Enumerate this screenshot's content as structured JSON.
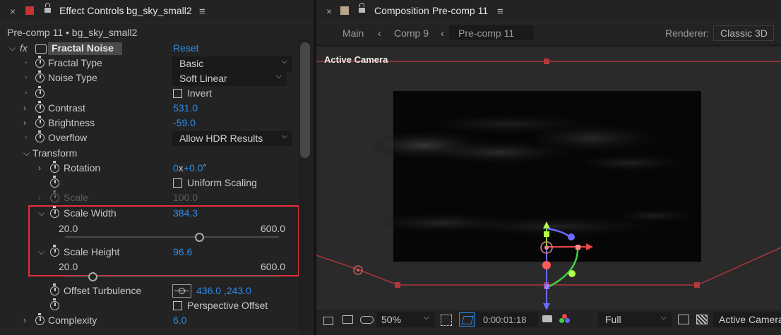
{
  "effect_panel": {
    "tab_close": "×",
    "tab_title": "Effect Controls",
    "tab_layer": "bg_sky_small2",
    "tab_menu": "≡",
    "subtitle": "Pre-comp 11 • bg_sky_small2",
    "effect": {
      "fx_label": "fx",
      "name": "Fractal Noise",
      "reset": "Reset"
    },
    "properties": {
      "fractal_type": {
        "label": "Fractal Type",
        "value": "Basic"
      },
      "noise_type": {
        "label": "Noise Type",
        "value": "Soft Linear"
      },
      "invert": {
        "label": "Invert"
      },
      "contrast": {
        "label": "Contrast",
        "value": "531.0"
      },
      "brightness": {
        "label": "Brightness",
        "value": "-59.0"
      },
      "overflow": {
        "label": "Overflow",
        "value": "Allow HDR Results"
      },
      "transform": {
        "label": "Transform"
      },
      "rotation": {
        "label": "Rotation",
        "value_turns": "0",
        "value_x": "x",
        "value_deg": "+0.0",
        "value_unit": "°"
      },
      "uniform_scaling": {
        "label": "Uniform Scaling"
      },
      "scale": {
        "label": "Scale",
        "value": "100.0"
      },
      "scale_width": {
        "label": "Scale Width",
        "value": "384.3",
        "min": "20.0",
        "max": "600.0",
        "position": 0.628
      },
      "scale_height": {
        "label": "Scale Height",
        "value": "96.6",
        "min": "20.0",
        "max": "600.0",
        "position": 0.132
      },
      "offset_turbulence": {
        "label": "Offset Turbulence",
        "value": "436.0 ,243.0"
      },
      "perspective_offset": {
        "label": "Perspective Offset"
      },
      "complexity": {
        "label": "Complexity",
        "value": "6.0"
      }
    },
    "colors": {
      "accent": "#2d8ceb",
      "label_swatch": "#c83232",
      "highlight": "#e0303a"
    }
  },
  "composition_panel": {
    "tab_close": "×",
    "tab_title": "Composition",
    "tab_comp": "Pre-comp 11",
    "tab_menu": "≡",
    "nav": {
      "main": "Main",
      "comp9": "Comp 9",
      "active": "Pre-comp 11",
      "renderer_label": "Renderer:",
      "renderer_value": "Classic 3D"
    },
    "viewer": {
      "camera_label": "Active Camera"
    },
    "bottom": {
      "zoom": "50%",
      "timecode": "0:00:01:18",
      "resolution": "Full",
      "view": "Active Camera"
    },
    "colors": {
      "swatch": "#b9a58a"
    }
  }
}
